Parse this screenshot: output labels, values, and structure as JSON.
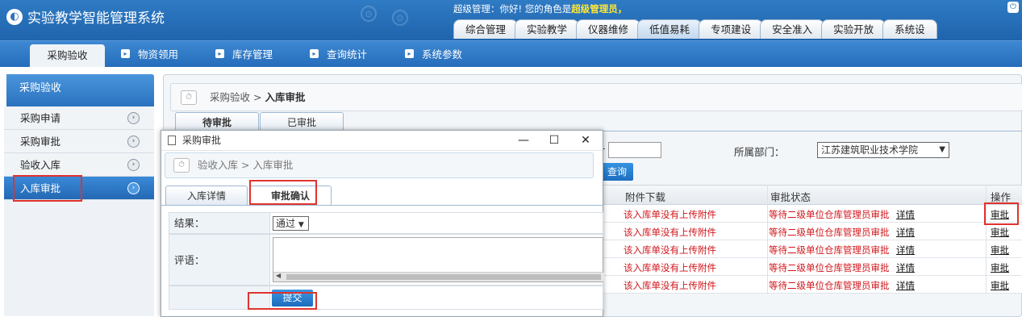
{
  "app": {
    "title": "实验教学智能管理系统",
    "greeting": "超级管理：你好! 您的角色是",
    "role": "超级管理员，"
  },
  "top_tabs": [
    "综合管理",
    "实验教学",
    "仪器维修",
    "低值易耗",
    "专项建设",
    "安全准入",
    "实验开放",
    "系统设"
  ],
  "top_tabs_active": "低值易耗",
  "subnav": {
    "active": "采购验收",
    "items": [
      "物资领用",
      "库存管理",
      "查询统计",
      "系统参数"
    ]
  },
  "sidebar": {
    "title": "采购验收",
    "items": [
      "采购申请",
      "采购审批",
      "验收入库",
      "入库审批"
    ],
    "active": "入库审批"
  },
  "page": {
    "crumb_parent": "采购验收",
    "crumb_sep": ">",
    "crumb_current": "入库审批",
    "tabs": [
      "待审批",
      "已审批"
    ]
  },
  "filters": {
    "dash": "-",
    "dept_label": "所属部门：",
    "dept_value": "江苏建筑职业技术学院",
    "query": "查询"
  },
  "grid": {
    "headers": [
      "附件下载",
      "审批状态",
      "操作"
    ],
    "rows": [
      {
        "attachment": "该入库单没有上传附件",
        "status": "等待二级单位仓库管理员审批",
        "detail": "详情",
        "action": "审批"
      },
      {
        "attachment": "该入库单没有上传附件",
        "status": "等待二级单位仓库管理员审批",
        "detail": "详情",
        "action": "审批"
      },
      {
        "attachment": "该入库单没有上传附件",
        "status": "等待二级单位仓库管理员审批",
        "detail": "详情",
        "action": "审批"
      },
      {
        "attachment": "该入库单没有上传附件",
        "status": "等待二级单位仓库管理员审批",
        "detail": "详情",
        "action": "审批"
      },
      {
        "attachment": "该入库单没有上传附件",
        "status": "等待二级单位仓库管理员审批",
        "detail": "详情",
        "action": "审批"
      }
    ]
  },
  "dialog": {
    "title": "采购审批",
    "crumb": "验收入库 > 入库审批",
    "tabs": [
      "入库详情",
      "审批确认"
    ],
    "active_tab": "审批确认",
    "result_label": "结果：",
    "result_value": "通过",
    "comment_label": "评语：",
    "submit": "提交"
  },
  "colors": {
    "header_blue": "#2f72bb",
    "highlight_red": "#e0332e",
    "status_red": "#d0161b",
    "role_yellow": "#ffe633"
  }
}
